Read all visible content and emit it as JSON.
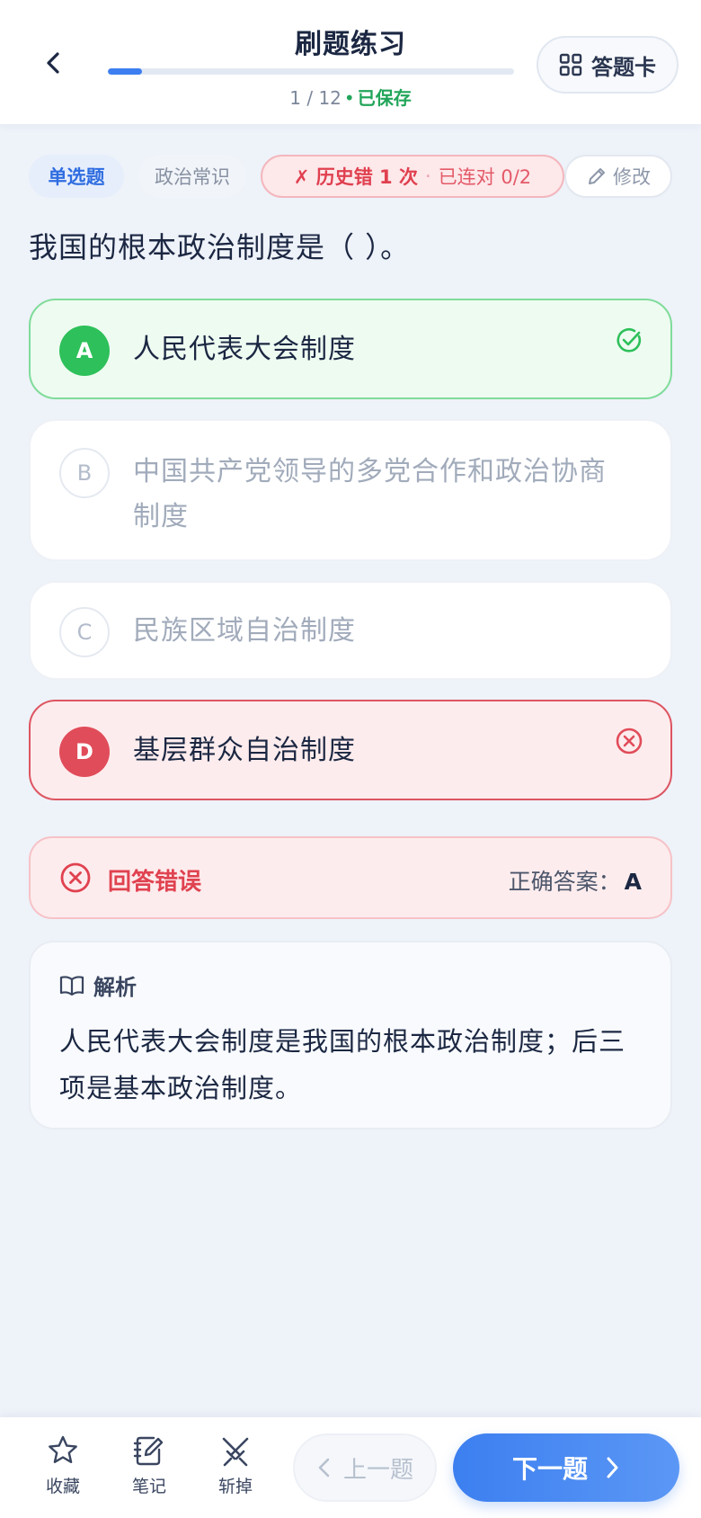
{
  "header": {
    "title": "刷题练习",
    "progress_current": 1,
    "progress_total": 12,
    "progress_text": "1 / 12",
    "progress_dot": "•",
    "saved_label": "已保存",
    "answer_card_label": "答题卡"
  },
  "tags": {
    "type": "单选题",
    "subject": "政治常识",
    "history_error": "✗ 历史错 1 次",
    "history_separator": "·",
    "streak": "已连对 0/2",
    "edit_label": "修改"
  },
  "question": {
    "text": "我国的根本政治制度是（ ）。"
  },
  "options": [
    {
      "letter": "A",
      "text": "人民代表大会制度",
      "state": "correct"
    },
    {
      "letter": "B",
      "text": "中国共产党领导的多党合作和政治协商制度",
      "state": "neutral"
    },
    {
      "letter": "C",
      "text": "民族区域自治制度",
      "state": "neutral"
    },
    {
      "letter": "D",
      "text": "基层群众自治制度",
      "state": "wrong-selected"
    }
  ],
  "result": {
    "status": "回答错误",
    "correct_answer_label": "正确答案：",
    "correct_answer_value": "A"
  },
  "explanation": {
    "title": "解析",
    "body": "人民代表大会制度是我国的根本政治制度；后三项是基本政治制度。"
  },
  "bottom_bar": {
    "favorite_label": "收藏",
    "note_label": "笔记",
    "cut_label": "斩掉",
    "prev_label": "上一题",
    "next_label": "下一题"
  },
  "colors": {
    "accent": "#3d7ef0",
    "correct": "#2ec05a",
    "wrong": "#e14c5a",
    "saved": "#22a55a"
  }
}
